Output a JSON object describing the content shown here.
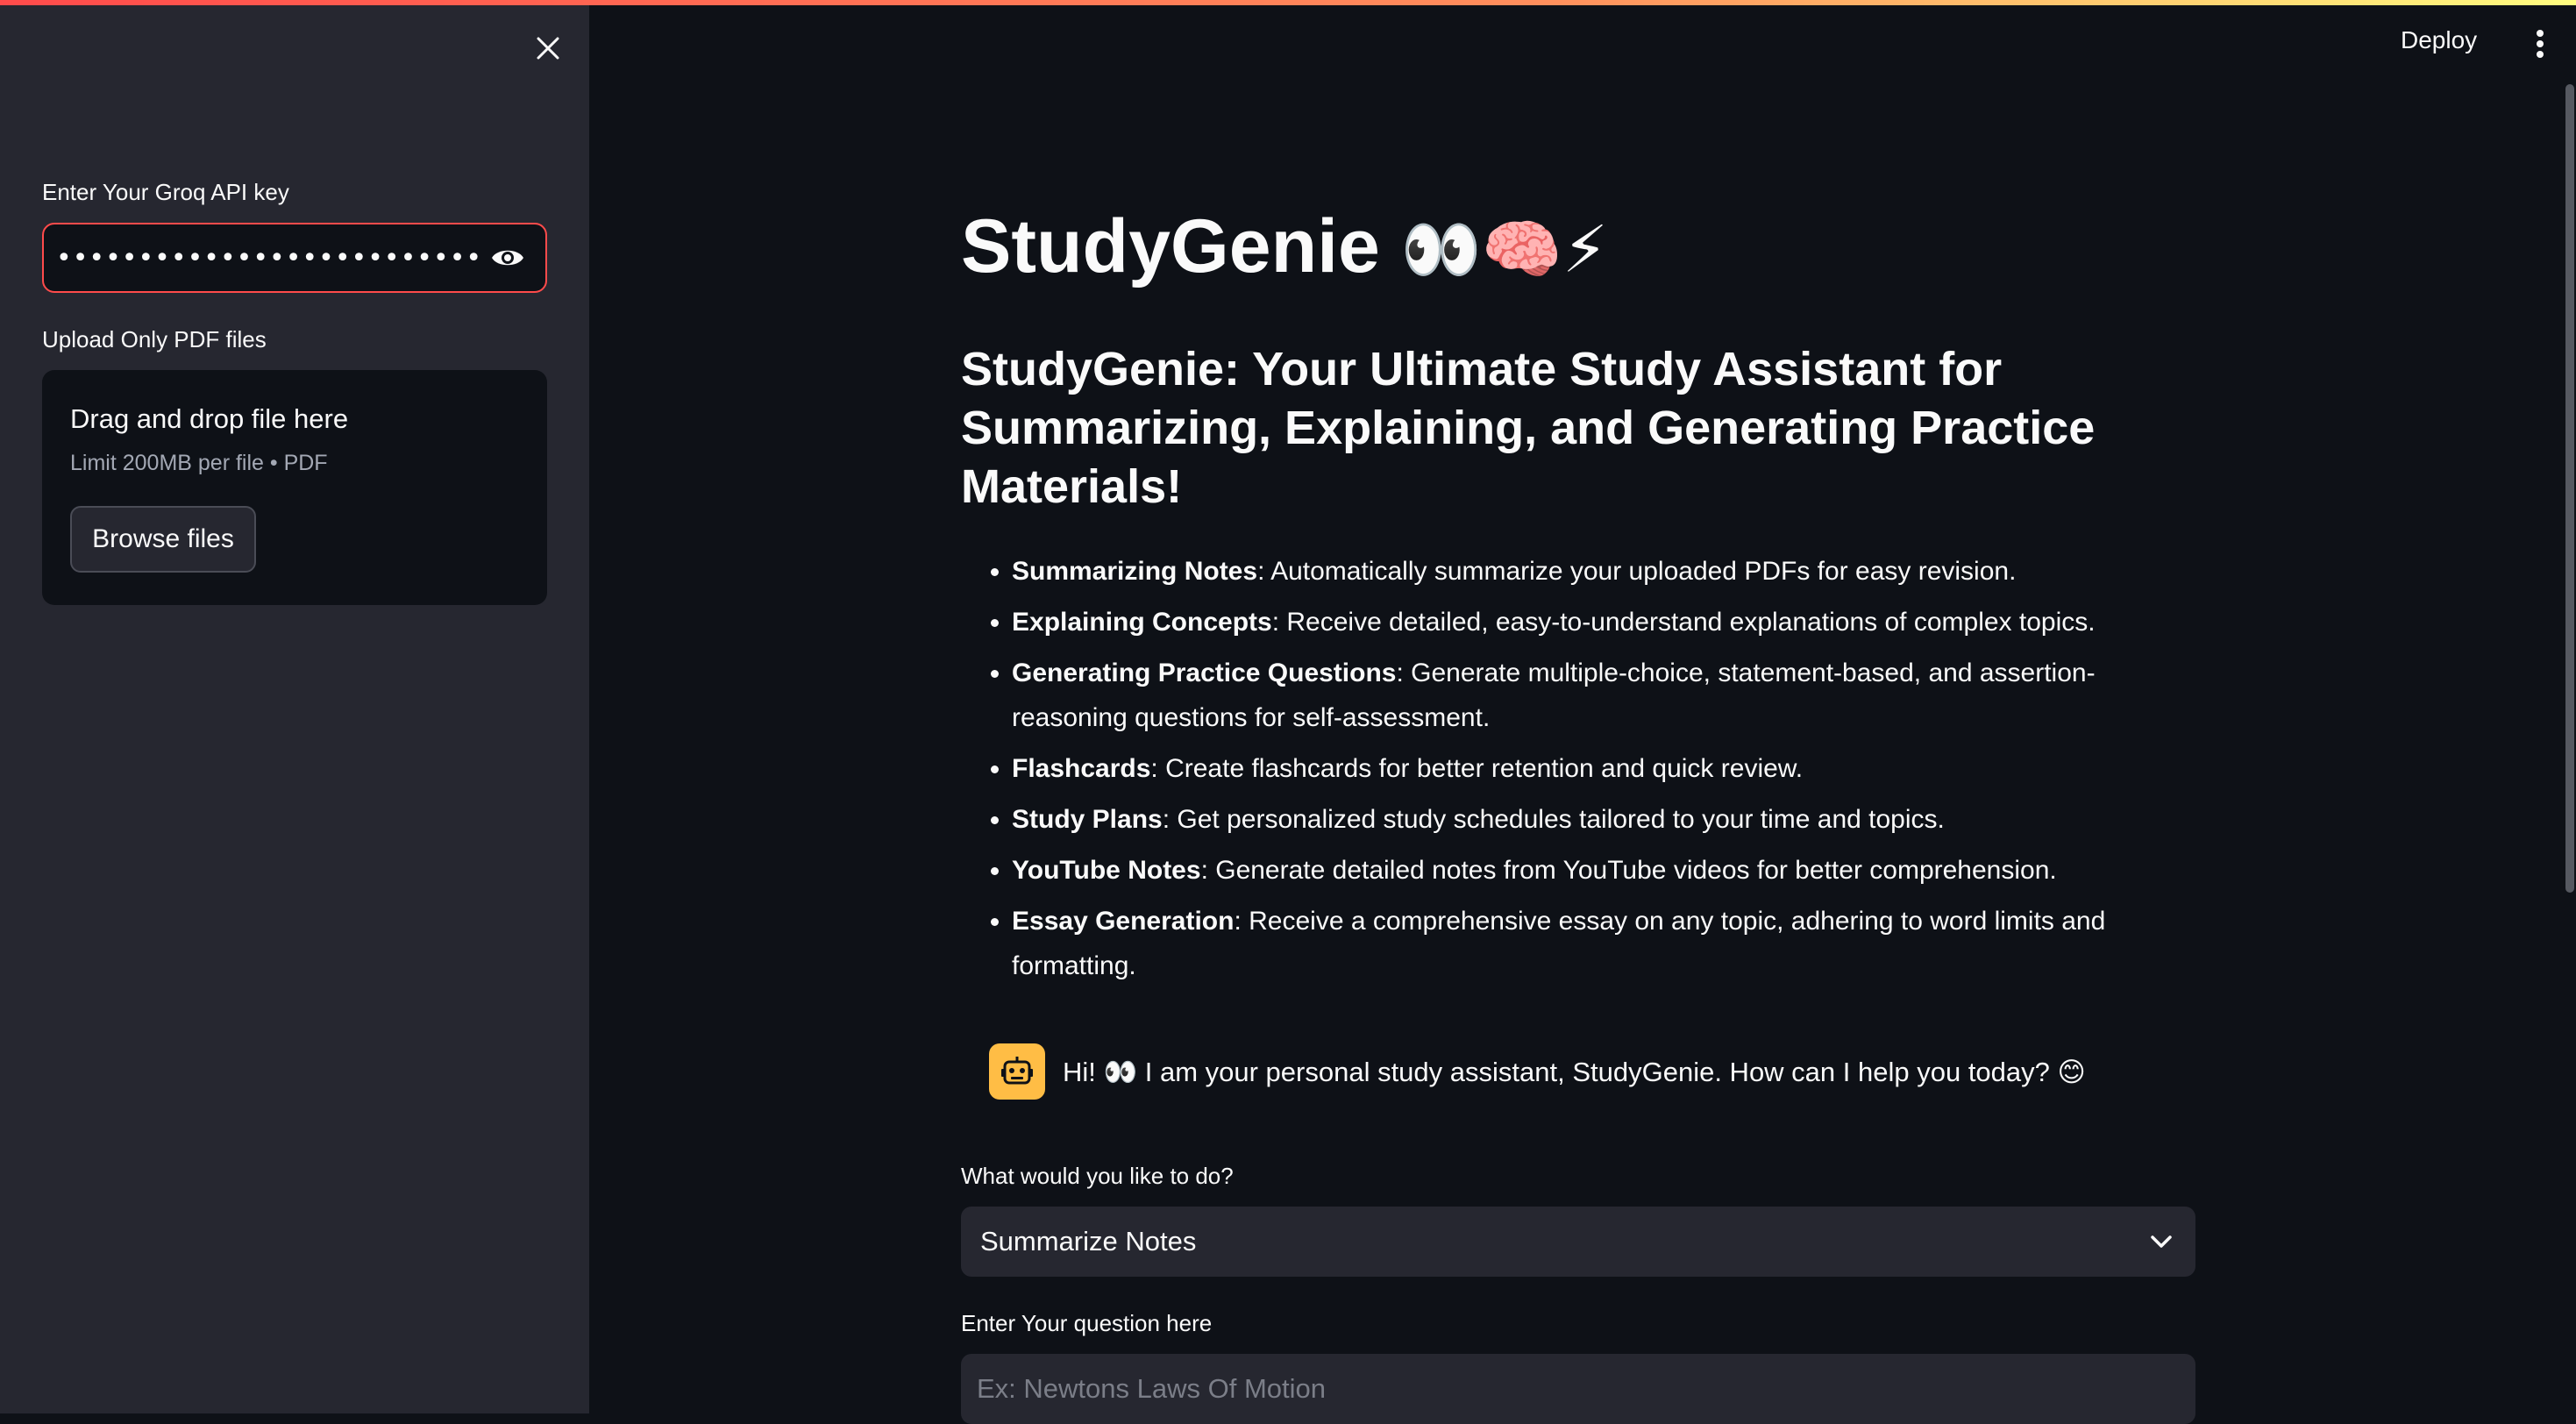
{
  "header": {
    "deploy_label": "Deploy"
  },
  "sidebar": {
    "api_key_label": "Enter Your Groq API key",
    "api_key_masked": "••••••••••••••••••••••••••••••••••••••••••••••••",
    "upload_label": "Upload Only PDF files",
    "dropzone_title": "Drag and drop file here",
    "dropzone_limit": "Limit 200MB per file • PDF",
    "browse_label": "Browse files"
  },
  "main": {
    "title": "StudyGenie",
    "title_emojis": "👀🧠⚡",
    "subtitle": "StudyGenie: Your Ultimate Study Assistant for Summarizing, Explaining, and Generating Practice Materials!",
    "features": [
      {
        "name": "Summarizing Notes",
        "desc": ": Automatically summarize your uploaded PDFs for easy revision."
      },
      {
        "name": "Explaining Concepts",
        "desc": ": Receive detailed, easy-to-understand explanations of complex topics."
      },
      {
        "name": "Generating Practice Questions",
        "desc": ": Generate multiple-choice, statement-based, and assertion-reasoning questions for self-assessment."
      },
      {
        "name": "Flashcards",
        "desc": ": Create flashcards for better retention and quick review."
      },
      {
        "name": "Study Plans",
        "desc": ": Get personalized study schedules tailored to your time and topics."
      },
      {
        "name": "YouTube Notes",
        "desc": ": Generate detailed notes from YouTube videos for better comprehension."
      },
      {
        "name": "Essay Generation",
        "desc": ": Receive a comprehensive essay on any topic, adhering to word limits and formatting."
      }
    ],
    "chat_greeting_prefix": "Hi! ",
    "chat_greeting_emoji": "👀",
    "chat_greeting_text": " I am your personal study assistant, StudyGenie. How can I help you today? ",
    "chat_greeting_smile": "😊",
    "action_label": "What would you like to do?",
    "action_selected": "Summarize Notes",
    "question_label": "Enter Your question here",
    "question_placeholder": "Ex: Newtons Laws Of Motion"
  },
  "colors": {
    "accent": "#ff4b4b",
    "sidebar_bg": "#262730",
    "app_bg": "#0e1117",
    "bot_avatar": "#ffbd45"
  }
}
